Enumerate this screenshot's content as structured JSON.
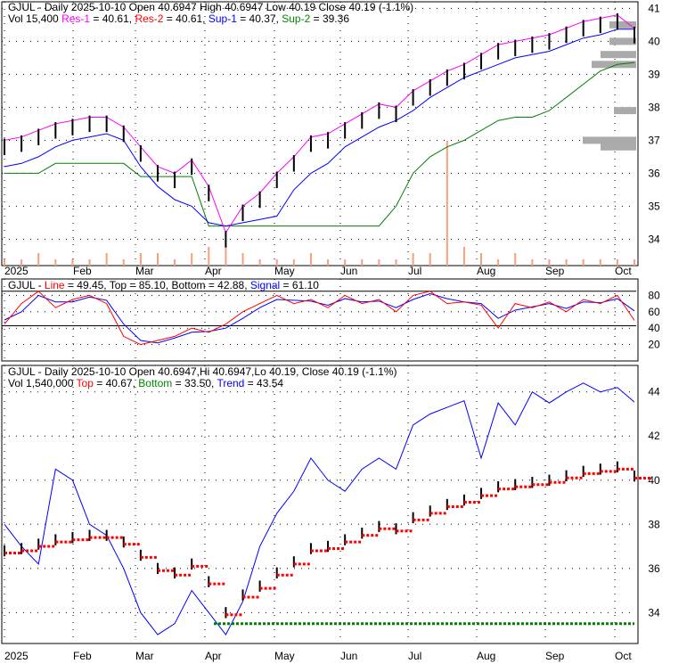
{
  "colors": {
    "res1": "#ff00ff",
    "res2": "#ff0000",
    "sup1": "#0000ff",
    "sup2": "#008000",
    "up": "#008000",
    "down": "#ff0000",
    "volume": "#f4a07a"
  },
  "panel1": {
    "title": "GJUL - Daily 2025-10-10 Open 40.6947  High 40.6947  Low 40.19  Close 40.19 (-1.1%)",
    "vol": "Vol 15,400",
    "res1": "Res-1",
    "res1_val": " = 40.61, ",
    "res2": "Res-2",
    "res2_val": " = 40.61, ",
    "sup1": "Sup-1",
    "sup1_val": " = 40.37, ",
    "sup2": "Sup-2",
    "sup2_val": " = 39.36"
  },
  "panel2": {
    "prefix": "GJUL - ",
    "line": "Line",
    "line_val": " = 49.45, Top = 85.10, Bottom = 42.88, ",
    "signal": "Signal",
    "signal_val": " = 61.10"
  },
  "panel3": {
    "title": "GJUL - Daily 2025-10-10 Open 40.6947,Hi 40.6947,Lo 40.19, Close 40.19 (-1.1%)",
    "vol": "Vol 1,540,000 ",
    "top": "Top",
    "top_val": " = 40.67, ",
    "bottom": "Bottom",
    "bottom_val": " = 33.50, ",
    "trend": "Trend",
    "trend_val": " = 43.54"
  },
  "chart_data": [
    {
      "type": "line",
      "title": "GJUL Daily price with support/resistance",
      "months": [
        "2025",
        "Feb",
        "Mar",
        "Apr",
        "May",
        "Jun",
        "Jul",
        "Aug",
        "Sep",
        "Oct"
      ],
      "yticks": [
        34,
        35,
        36,
        37,
        38,
        39,
        40,
        41
      ],
      "ylim": [
        33.2,
        41.2
      ],
      "close": [
        36.8,
        36.9,
        37.1,
        37.3,
        37.4,
        37.5,
        37.5,
        37.2,
        36.6,
        36.0,
        35.8,
        36.2,
        35.4,
        34.0,
        34.8,
        35.2,
        35.8,
        36.3,
        36.9,
        37.0,
        37.3,
        37.6,
        37.9,
        37.8,
        38.3,
        38.6,
        38.9,
        39.1,
        39.4,
        39.7,
        39.8,
        39.9,
        40.0,
        40.2,
        40.4,
        40.5,
        40.6,
        40.19
      ],
      "sup1": [
        36.2,
        36.3,
        36.5,
        36.8,
        37.0,
        37.1,
        37.2,
        37.0,
        36.2,
        35.6,
        35.2,
        35.0,
        34.5,
        34.4,
        34.5,
        34.6,
        34.7,
        35.5,
        36.0,
        36.3,
        36.8,
        37.1,
        37.4,
        37.6,
        37.9,
        38.3,
        38.6,
        38.9,
        39.1,
        39.3,
        39.5,
        39.6,
        39.7,
        39.9,
        40.1,
        40.2,
        40.37,
        40.37
      ],
      "sup2": [
        36.0,
        36.0,
        36.0,
        36.3,
        36.3,
        36.3,
        36.3,
        36.3,
        35.9,
        35.9,
        35.9,
        35.9,
        34.4,
        34.4,
        34.4,
        34.4,
        34.4,
        34.4,
        34.4,
        34.4,
        34.4,
        34.4,
        34.4,
        35.0,
        36.0,
        36.5,
        36.8,
        37.0,
        37.3,
        37.6,
        37.7,
        37.7,
        37.9,
        38.3,
        38.7,
        39.1,
        39.3,
        39.36
      ],
      "volume": [
        1,
        1,
        2,
        1,
        1,
        1,
        2,
        1,
        2,
        2,
        1,
        2,
        3,
        4,
        2,
        1,
        1,
        1,
        2,
        1,
        1,
        1,
        1,
        1,
        2,
        2,
        20,
        3,
        2,
        1,
        2,
        1,
        1,
        1,
        1,
        1,
        1,
        1
      ]
    },
    {
      "type": "line",
      "title": "Stochastic",
      "yticks": [
        20,
        40,
        60,
        80
      ],
      "ylim": [
        0,
        100
      ],
      "line": [
        45,
        70,
        85,
        65,
        75,
        80,
        70,
        30,
        20,
        25,
        30,
        40,
        35,
        45,
        60,
        70,
        80,
        70,
        75,
        65,
        80,
        70,
        75,
        60,
        80,
        85,
        70,
        72,
        68,
        40,
        70,
        65,
        72,
        60,
        75,
        70,
        80,
        49.45
      ],
      "signal": [
        50,
        60,
        80,
        72,
        72,
        78,
        74,
        45,
        25,
        22,
        28,
        35,
        36,
        40,
        52,
        65,
        75,
        74,
        73,
        68,
        76,
        72,
        73,
        65,
        75,
        82,
        76,
        72,
        70,
        52,
        62,
        66,
        70,
        64,
        72,
        71,
        76,
        61.1
      ],
      "top": 85.1,
      "bottom": 42.88
    },
    {
      "type": "line",
      "title": "Price with trend",
      "yticks": [
        34,
        36,
        38,
        40,
        42,
        44
      ],
      "ylim": [
        32.6,
        45.2
      ],
      "trend": [
        38,
        37,
        36.2,
        40.5,
        40,
        38,
        37.5,
        36,
        34,
        33,
        33.5,
        35,
        34,
        33,
        34.5,
        37,
        38.5,
        39.5,
        41,
        40,
        39.5,
        40.5,
        41,
        40.5,
        42.5,
        43,
        43.3,
        43.6,
        41,
        43.5,
        42.5,
        44,
        43.5,
        44,
        44.4,
        44,
        44.2,
        43.54
      ],
      "top": 40.67,
      "bottom": 33.5
    }
  ]
}
